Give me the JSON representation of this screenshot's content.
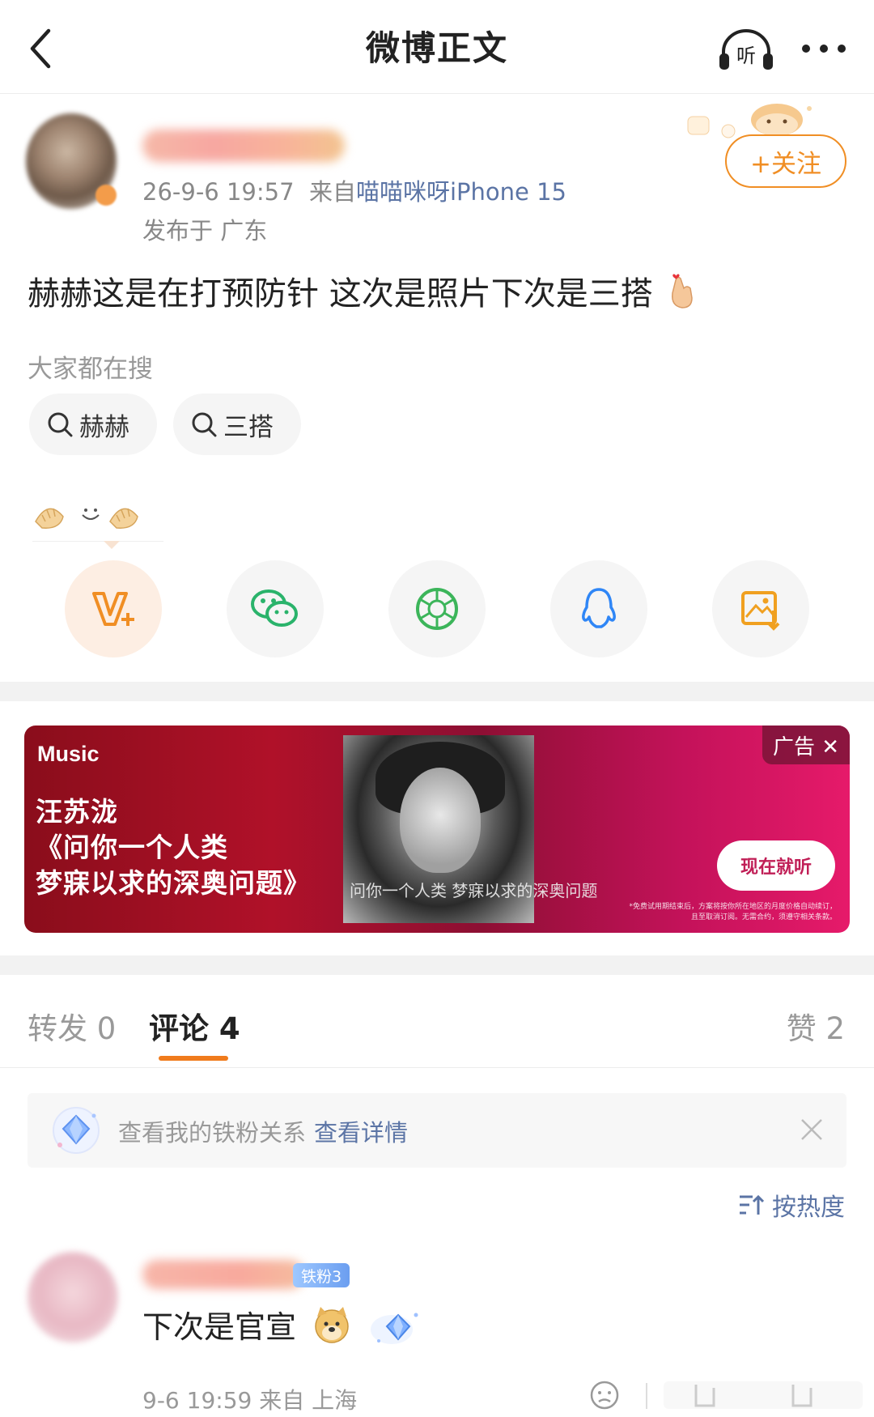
{
  "header": {
    "title": "微博正文",
    "listen_label": "听"
  },
  "author": {
    "timestamp": "26-9-6 19:57",
    "source_prefix": "来自",
    "source_device": "喵喵咪呀iPhone 15",
    "location": "发布于 广东",
    "follow_label": "+关注"
  },
  "post": {
    "text": "赫赫这是在打预防针 这次是照片下次是三搭"
  },
  "search": {
    "heading": "大家都在搜",
    "tags": [
      "赫赫",
      "三搭"
    ]
  },
  "share_icons": [
    "vplus-icon",
    "wechat-icon",
    "moments-icon",
    "qq-icon",
    "save-image-icon"
  ],
  "ad": {
    "brand": "Music",
    "line1": "汪苏泷",
    "line2": "《问你一个人类",
    "line3": "梦寐以求的深奥问题》",
    "photo_text": "问你一个人类 梦寐以求的深奥问题",
    "tag": "广告 ✕",
    "button": "现在就听",
    "fine1": "*免费试用期结束后，方案将按你所在地区的月度价格自动续订，",
    "fine2": "且至取消订阅。无需合约，须遵守相关条款。"
  },
  "tabs": {
    "repost": "转发 0",
    "comment": "评论 4",
    "like": "赞 2"
  },
  "fan_bar": {
    "text": "查看我的铁粉关系",
    "link": "查看详情"
  },
  "sort": {
    "label": "按热度"
  },
  "comment": {
    "badge": "铁粉3",
    "text": "下次是官宣",
    "meta": "9-6 19:59 来自 上海"
  },
  "colors": {
    "accent_orange": "#f08e24",
    "link_blue": "#5b74a5",
    "ad_red": "#b01129"
  }
}
